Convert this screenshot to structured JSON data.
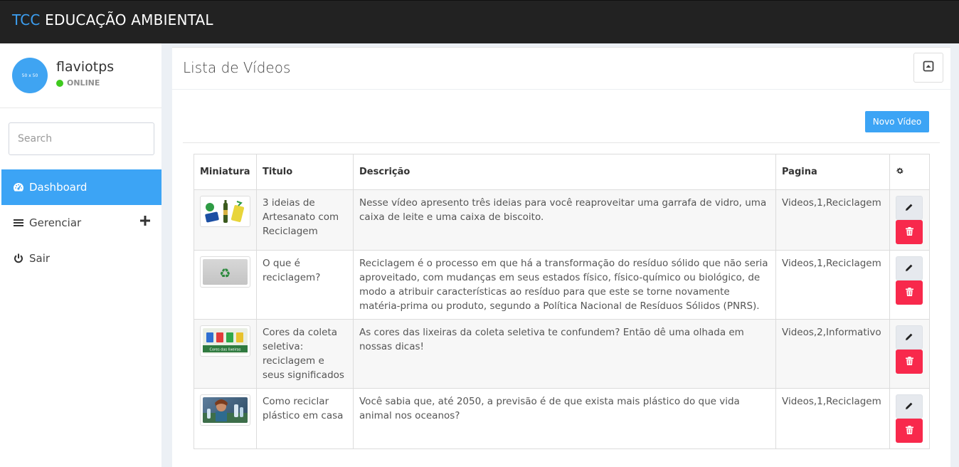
{
  "brand": {
    "prefix": "TCC",
    "name": "EDUCAÇÃO AMBIENTAL"
  },
  "user": {
    "avatar_text": "50 x 50",
    "name": "flaviotps",
    "status": "ONLINE"
  },
  "sidebar": {
    "search_placeholder": "Search",
    "items": [
      {
        "label": "Dashboard",
        "icon": "dashboard-icon"
      },
      {
        "label": "Gerenciar",
        "icon": "bars-icon"
      },
      {
        "label": "Sair",
        "icon": "power-icon"
      }
    ]
  },
  "main": {
    "title": "Lista de Vídeos",
    "new_button": "Novo Vídeo",
    "table": {
      "headers": [
        "Miniatura",
        "Titulo",
        "Descrição",
        "Pagina"
      ],
      "settings_icon": "gear-icon",
      "rows": [
        {
          "title": "3 ideias de Artesanato com Reciclagem",
          "description": "Nesse vídeo apresento três ideias para você reaproveitar uma garrafa de vidro, uma caixa de leite e uma caixa de biscoito.",
          "page": "Videos,1,Reciclagem",
          "thumb": "recycle-crafts-thumbnail"
        },
        {
          "title": "O que é reciclagem?",
          "description": "Reciclagem é o processo em que há a transformação do resíduo sólido que não seria aproveitado, com mudanças em seus estados físico, físico-químico ou biológico, de modo a atribuir características ao resíduo para que este se torne novamente matéria-prima ou produto, segundo a Política Nacional de Resíduos Sólidos (PNRS).",
          "page": "Videos,1,Reciclagem",
          "thumb": "recycle-symbol-thumbnail"
        },
        {
          "title": "Cores da coleta seletiva: reciclagem e seus significados",
          "description": "As cores das lixeiras da coleta seletiva te confundem? Então dê uma olhada em nossas dicas!",
          "page": "Videos,2,Informativo",
          "thumb": "recycling-bins-thumbnail",
          "thumb_caption": "Cores das lixeiras"
        },
        {
          "title": "Como reciclar plástico em casa",
          "description": "Você sabia que, até 2050, a previsão é de que exista mais plástico do que vida animal nos oceanos?",
          "page": "Videos,1,Reciclagem",
          "thumb": "plastic-recycling-thumbnail"
        }
      ]
    }
  },
  "colors": {
    "accent": "#3ca4f5",
    "danger": "#f8294c",
    "topbar": "#222222",
    "online": "#3fca1e"
  }
}
